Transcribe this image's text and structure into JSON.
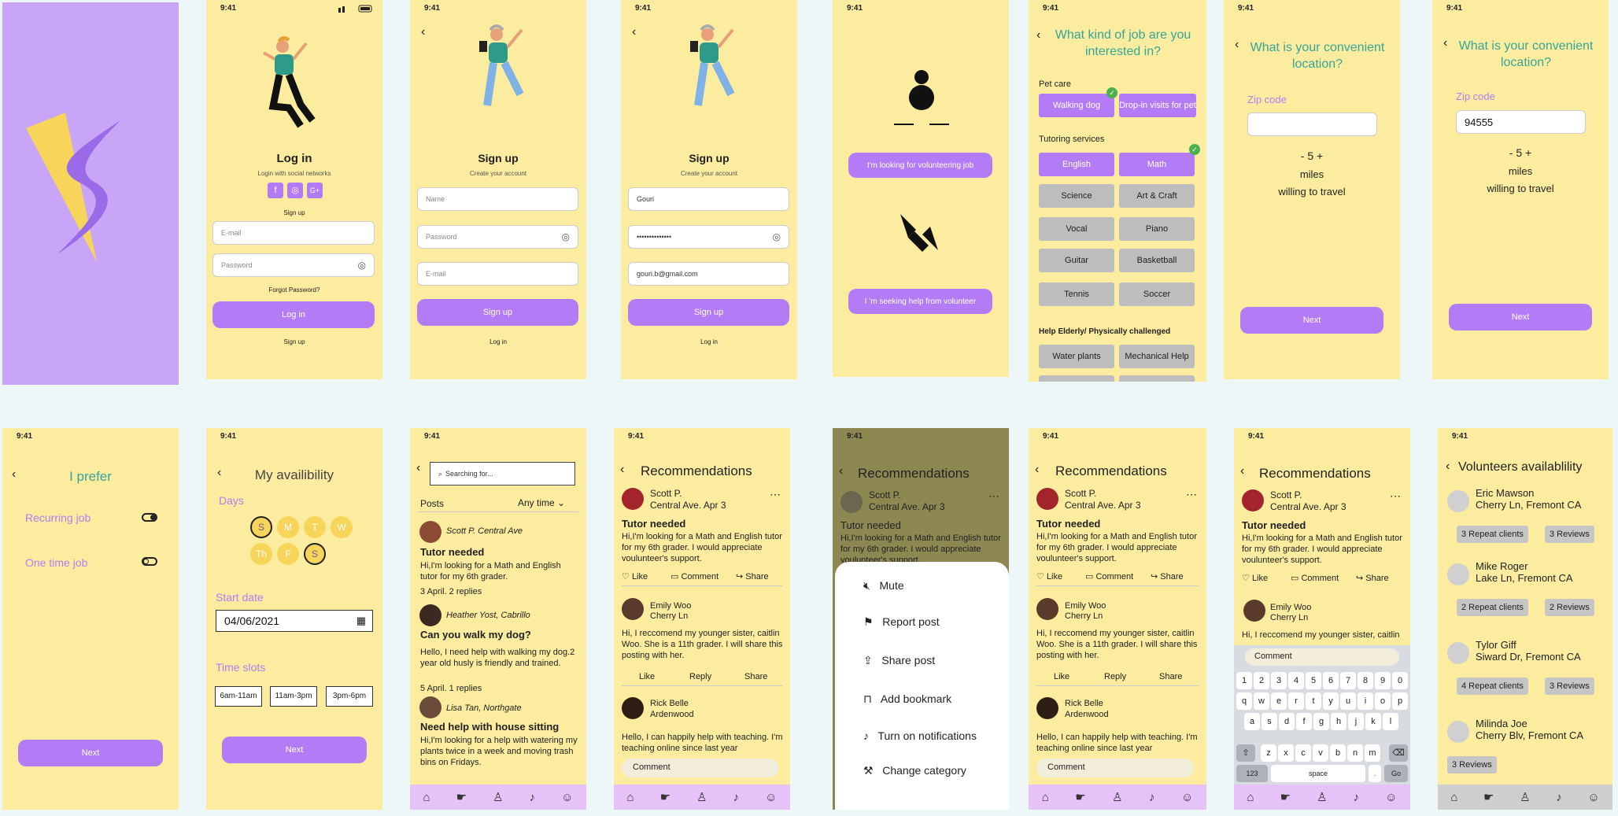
{
  "status_time": "9:41",
  "login": {
    "title": "Log in",
    "social": "Login with social networks",
    "signup_link": "Sign up",
    "email_ph": "E-mail",
    "password_ph": "Password",
    "forgot": "Forgot Password?",
    "button": "Log in",
    "bottom_link": "Sign up"
  },
  "signup": {
    "title": "Sign up",
    "subtitle": "Create your account",
    "name_ph": "Name",
    "password_ph": "Password",
    "email_ph": "E-mail",
    "button": "Sign up",
    "bottom_link": "Log in"
  },
  "signup_filled": {
    "title": "Sign up",
    "subtitle": "Create your account",
    "name": "Gouri",
    "password": "••••••••••••••",
    "email": "gouri.b@gmail.com",
    "button": "Sign up",
    "bottom_link": "Log in"
  },
  "role": {
    "volunteer_btn": "I'm looking for volunteering job",
    "seeker_btn": "I 'm seeking help from volunteer"
  },
  "interests": {
    "title": "What kind of job are you interested in?",
    "sections": [
      {
        "label": "Pet care",
        "tags": [
          {
            "t": "Walking dog",
            "on": true
          },
          {
            "t": "Drop-in visits for pet",
            "on": true
          }
        ]
      },
      {
        "label": "Tutoring services",
        "tags": [
          {
            "t": "English",
            "on": true
          },
          {
            "t": "Math",
            "on": true
          },
          {
            "t": "Science",
            "on": false
          },
          {
            "t": "Art & Craft",
            "on": false
          },
          {
            "t": "Vocal",
            "on": false
          },
          {
            "t": "Piano",
            "on": false
          },
          {
            "t": "Guitar",
            "on": false
          },
          {
            "t": "Basketball",
            "on": false
          },
          {
            "t": "Tennis",
            "on": false
          },
          {
            "t": "Soccer",
            "on": false
          }
        ]
      },
      {
        "label": "Help Elderly/ Physically challenged",
        "tags": [
          {
            "t": "Water plants",
            "on": false
          },
          {
            "t": "Mechanical Help",
            "on": false
          }
        ]
      }
    ]
  },
  "location": {
    "title": "What is your convenient location?",
    "zip_label": "Zip code",
    "zip_value": "94555",
    "stepper": "- 5 +",
    "miles": "miles",
    "willing": "willing to travel",
    "button": "Next"
  },
  "prefer": {
    "title": "I prefer",
    "recurring": "Recurring job",
    "onetime": "One time job",
    "button": "Next"
  },
  "availability": {
    "title": "My availibility",
    "days_label": "Days",
    "days": [
      "S",
      "M",
      "T",
      "W",
      "Th",
      "F",
      "S"
    ],
    "start_label": "Start date",
    "start_date": "04/06/2021",
    "slots_label": "Time slots",
    "slots": [
      "6am-11am",
      "11am-3pm",
      "3pm-6pm"
    ],
    "button": "Next"
  },
  "search": {
    "placeholder": "Searching for...",
    "posts_label": "Posts",
    "filter": "Any time",
    "posts": [
      {
        "author": "Scott P.  Central Ave",
        "title": "Tutor needed",
        "body": "Hi,I'm looking for a Math and English tutor for my 6th grader.",
        "meta": "3 April. 2 replies"
      },
      {
        "author": "Heather Yost, Cabrillo",
        "title": "Can you walk my dog?",
        "body": "Hello, I need help with walking my dog.2 year old husly is friendly and trained.",
        "meta": "5 April. 1 replies"
      },
      {
        "author": "Lisa Tan, Northgate",
        "title": "Need help with house sitting",
        "body": "Hi,I'm looking for a help with watering my plants twice in a week and moving trash bins on Fridays.",
        "meta": ""
      }
    ]
  },
  "reco": {
    "title": "Recommendations",
    "author": "Scott P.",
    "meta": "Central Ave. Apr 3",
    "post_title": "Tutor needed",
    "post_body": "Hi,I'm looking for a Math and English tutor for my 6th grader. I would appreciate voulunteer's support.",
    "like": "Like",
    "comment": "Comment",
    "share": "Share",
    "reply1_name": "Emily Woo",
    "reply1_loc": "Cherry Ln",
    "reply1_body": "Hi, I reccomend my younger sister, caitlin Woo. She is a 11th grader. I will share this posting with her.",
    "reply": "Reply",
    "reply2_name": "Rick Belle",
    "reply2_loc": "Ardenwood",
    "reply2_body": "Hello, I can happily help with teaching. I'm teaching online since last year",
    "comment_ph": "Comment"
  },
  "menu": {
    "items": [
      "Mute",
      "Report post",
      "Share post",
      "Add bookmark",
      "Turn on notifications",
      "Change category"
    ]
  },
  "keyboard": {
    "row1": [
      "1",
      "2",
      "3",
      "4",
      "5",
      "6",
      "7",
      "8",
      "9",
      "0"
    ],
    "row2": [
      "q",
      "w",
      "e",
      "r",
      "t",
      "y",
      "u",
      "i",
      "o",
      "p"
    ],
    "row3": [
      "a",
      "s",
      "d",
      "f",
      "g",
      "h",
      "j",
      "k",
      "l"
    ],
    "row4": [
      "z",
      "x",
      "c",
      "v",
      "b",
      "n",
      "m"
    ],
    "num": "123",
    "space": "space",
    "go": "Go"
  },
  "volunteers": {
    "title": "Volunteers availablility",
    "list": [
      {
        "name": "Eric Mawson",
        "addr": "Cherry Ln, Fremont CA",
        "repeat": "3 Repeat clients",
        "reviews": "3 Reviews"
      },
      {
        "name": "Mike Roger",
        "addr": "Lake Ln, Fremont CA",
        "repeat": "2 Repeat clients",
        "reviews": "2 Reviews"
      },
      {
        "name": "Tylor Giff",
        "addr": "Siward Dr, Fremont CA",
        "repeat": "4 Repeat clients",
        "reviews": "3 Reviews"
      },
      {
        "name": "Milinda Joe",
        "addr": "Cherry Blv, Fremont CA",
        "repeat": "",
        "reviews": "3 Reviews"
      }
    ]
  },
  "colors": {
    "bg": "#fcec9f",
    "accent": "#b37cf6",
    "teal": "#36a59a",
    "splash": "#c9a5f7"
  }
}
